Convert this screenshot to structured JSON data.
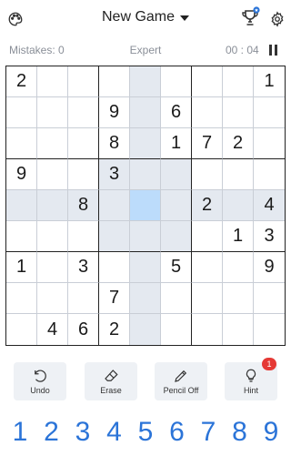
{
  "header": {
    "title": "New Game"
  },
  "info": {
    "mistakes": "Mistakes: 0",
    "difficulty": "Expert",
    "timer": "00 : 04"
  },
  "board": {
    "rows": [
      [
        "2",
        "",
        "",
        "",
        "",
        "",
        "",
        "",
        "1"
      ],
      [
        "",
        "",
        "",
        "9",
        "",
        "6",
        "",
        "",
        ""
      ],
      [
        "",
        "",
        "",
        "8",
        "",
        "1",
        "7",
        "2",
        ""
      ],
      [
        "9",
        "",
        "",
        "3",
        "",
        "",
        "",
        "",
        ""
      ],
      [
        "",
        "",
        "8",
        "",
        "",
        "",
        "2",
        "",
        "4"
      ],
      [
        "",
        "",
        "",
        "",
        "",
        "",
        "",
        "1",
        "3"
      ],
      [
        "1",
        "",
        "3",
        "",
        "",
        "5",
        "",
        "",
        "9"
      ],
      [
        "",
        "",
        "",
        "7",
        "",
        "",
        "",
        "",
        ""
      ],
      [
        "",
        "4",
        "6",
        "2",
        "",
        "",
        "",
        "",
        ""
      ]
    ],
    "selected": [
      4,
      4
    ]
  },
  "tools": {
    "undo": "Undo",
    "erase": "Erase",
    "pencil": "Pencil Off",
    "hint": "Hint",
    "hint_count": "1"
  },
  "numpad": [
    "1",
    "2",
    "3",
    "4",
    "5",
    "6",
    "7",
    "8",
    "9"
  ],
  "icons": {
    "theme": "palette-icon",
    "trophy": "trophy-icon",
    "settings": "gear-icon"
  },
  "colors": {
    "accent": "#2b74d8",
    "highlight": "#e4e9f0",
    "selected": "#bcdcfb",
    "badge": "#e53935"
  }
}
